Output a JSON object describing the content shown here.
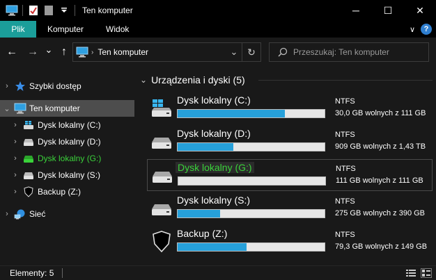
{
  "window": {
    "title": "Ten komputer",
    "minimize_glyph": "─",
    "maximize_glyph": "☐",
    "close_glyph": "✕"
  },
  "ribbon": {
    "tabs": [
      "Plik",
      "Komputer",
      "Widok"
    ],
    "expand_glyph": "∨",
    "help_glyph": "?"
  },
  "address": {
    "crumb": "Ten komputer",
    "back_glyph": "←",
    "forward_glyph": "→",
    "recent_glyph": "⌄",
    "up_glyph": "↑",
    "dropdown_glyph": "⌄",
    "refresh_glyph": "↻"
  },
  "search": {
    "placeholder": "Przeszukaj: Ten komputer"
  },
  "nav": {
    "quick_access": "Szybki dostęp",
    "this_pc": "Ten komputer",
    "drives": [
      {
        "label": "Dysk lokalny (C:)",
        "icon": "windows-drive-icon",
        "highlight": false
      },
      {
        "label": "Dysk lokalny (D:)",
        "icon": "drive-icon",
        "highlight": false
      },
      {
        "label": "Dysk lokalny (G:)",
        "icon": "green-drive-icon",
        "highlight": true
      },
      {
        "label": "Dysk lokalny (S:)",
        "icon": "drive-icon",
        "highlight": false
      },
      {
        "label": "Backup (Z:)",
        "icon": "shield-drive-icon",
        "highlight": false
      }
    ],
    "network": "Sieć"
  },
  "group": {
    "title": "Urządzenia i dyski (5)"
  },
  "drives": [
    {
      "name": "Dysk lokalny (C:)",
      "fs": "NTFS",
      "free": "30,0 GB wolnych z 111 GB",
      "used_fraction": 0.73,
      "icon": "windows-drive-icon"
    },
    {
      "name": "Dysk lokalny (D:)",
      "fs": "NTFS",
      "free": "909 GB wolnych z 1,43 TB",
      "used_fraction": 0.38,
      "icon": "drive-icon"
    },
    {
      "name": "Dysk lokalny (G:)",
      "fs": "NTFS",
      "free": "111 GB wolnych z 111 GB",
      "used_fraction": 0.0,
      "icon": "drive-icon"
    },
    {
      "name": "Dysk lokalny (S:)",
      "fs": "NTFS",
      "free": "275 GB wolnych z 390 GB",
      "used_fraction": 0.29,
      "icon": "drive-icon"
    },
    {
      "name": "Backup (Z:)",
      "fs": "NTFS",
      "free": "79,3 GB wolnych z 149 GB",
      "used_fraction": 0.47,
      "icon": "shield-drive-icon"
    }
  ],
  "status": {
    "count": "Elementy: 5"
  },
  "colors": {
    "accent": "#1b9e9a",
    "bar_fill": "#26a0da",
    "highlight_green": "#3ad23a",
    "selection": "#4d4d4d"
  }
}
